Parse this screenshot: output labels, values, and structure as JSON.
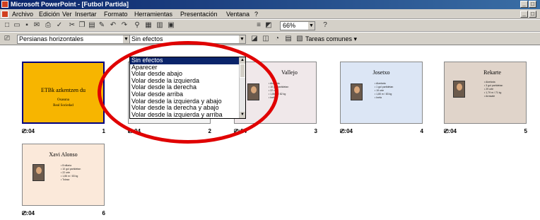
{
  "window": {
    "title": "Microsoft PowerPoint - [Futbol Partida]"
  },
  "menu": [
    "Archivo",
    "Edición",
    "Ver",
    "Insertar",
    "Formato",
    "Herramientas",
    "Presentación",
    "Ventana",
    "?"
  ],
  "toolbar": {
    "zoom": "66%"
  },
  "transition_toolbar": {
    "transition": "Persianas horizontales",
    "effect": "Sin efectos",
    "tasks_label": "Tareas comunes"
  },
  "effect_options": [
    "Sin efectos",
    "Aparecer",
    "Volar desde abajo",
    "Volar desde la izquierda",
    "Volar desde la derecha",
    "Volar desde arriba",
    "Volar desde la izquierda y abajo",
    "Volar desde la derecha y abajo",
    "Volar desde la izquierda y arriba"
  ],
  "slides": [
    {
      "num": "1",
      "time": ":04",
      "title": "ETBk azkentzen du",
      "sub1": "Osasuna",
      "sub2": "Real Sociedad",
      "bg": "#f7b500",
      "bullets": []
    },
    {
      "num": "2",
      "time": ":04",
      "title": "",
      "bg": "#f4f4f4",
      "bullets": []
    },
    {
      "num": "3",
      "time": ":04",
      "title": "Vallejo",
      "bg": "#f0e8ea",
      "bullets": [
        "Atzelaria",
        "10 gol partidetan",
        "22 urte",
        "1,86 m / 82 kg",
        "Inefa"
      ]
    },
    {
      "num": "4",
      "time": ":04",
      "title": "Josetxo",
      "bg": "#dce6f5",
      "bullets": [
        "Atzelaria",
        "1 gol partidetan",
        "19 urte",
        "1,80 m / 83 kg",
        "Inefa"
      ]
    },
    {
      "num": "5",
      "time": ":04",
      "title": "Rekarte",
      "bg": "#e0d4ca",
      "bullets": [
        "Atzelaria",
        "3 gol partidetan",
        "29 urte",
        "1,79 m / 71 kg",
        "Arrasate"
      ]
    },
    {
      "num": "6",
      "time": ":04",
      "title": "Xavi Alonso",
      "bg": "#fbe9da",
      "bullets": [
        "Erdilaria",
        "10 gol partidetan",
        "22 urte",
        "1,86 m / 83 kg",
        "Tolosa"
      ]
    }
  ]
}
